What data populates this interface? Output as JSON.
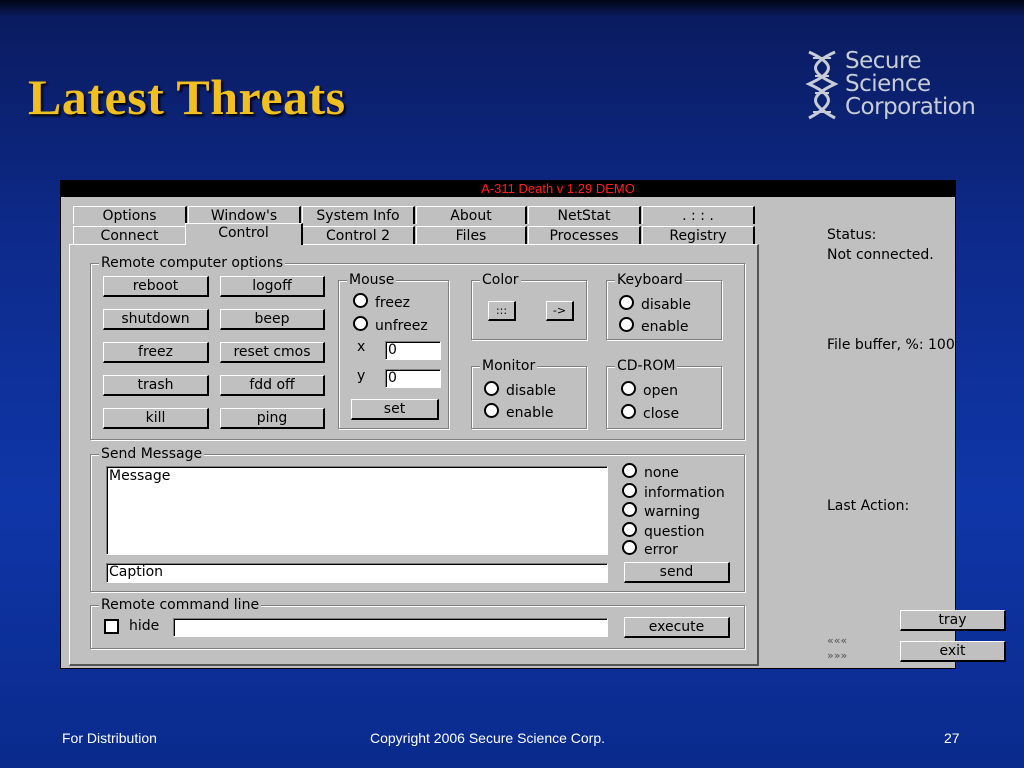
{
  "slide": {
    "title": "Latest Threats",
    "logo_lines": [
      "Secure",
      "Science",
      "Corporation"
    ],
    "footer_left": "For Distribution",
    "footer_center": "Copyright 2006 Secure Science Corp.",
    "footer_right": "27"
  },
  "window": {
    "title": "A-311 Death v 1.29 DEMO",
    "tabs_row1": [
      "Options",
      "Window's",
      "System Info",
      "About",
      "NetStat",
      ". : : ."
    ],
    "tabs_row2": [
      "Connect",
      "Control",
      "Control 2",
      "Files",
      "Processes",
      "Registry"
    ],
    "active_tab": "Control",
    "remote": {
      "legend": "Remote computer options",
      "buttons": [
        "reboot",
        "logoff",
        "shutdown",
        "beep",
        "freez",
        "reset cmos",
        "trash",
        "fdd off",
        "kill",
        "ping"
      ]
    },
    "mouse": {
      "legend": "Mouse",
      "opt1": "freez",
      "opt2": "unfreez",
      "x_label": "x",
      "x_value": "0",
      "y_label": "y",
      "y_value": "0",
      "set": "set"
    },
    "color": {
      "legend": "Color",
      "btn1": ":::",
      "btn2": "->"
    },
    "keyboard": {
      "legend": "Keyboard",
      "opt1": "disable",
      "opt2": "enable"
    },
    "monitor": {
      "legend": "Monitor",
      "opt1": "disable",
      "opt2": "enable"
    },
    "cdrom": {
      "legend": "CD-ROM",
      "opt1": "open",
      "opt2": "close"
    },
    "message": {
      "legend": "Send Message",
      "body": "Message",
      "caption": "Caption",
      "types": [
        "none",
        "information",
        "warning",
        "question",
        "error"
      ],
      "send": "send"
    },
    "command": {
      "legend": "Remote command line",
      "hide": "hide",
      "execute": "execute"
    },
    "side": {
      "status_label": "Status:",
      "status_value": "Not connected.",
      "buffer": "File buffer, %: 100",
      "last_action": "Last Action:",
      "tray": "tray",
      "exit": "exit",
      "arrows_left": "«««",
      "arrows_right": "»»»"
    }
  }
}
